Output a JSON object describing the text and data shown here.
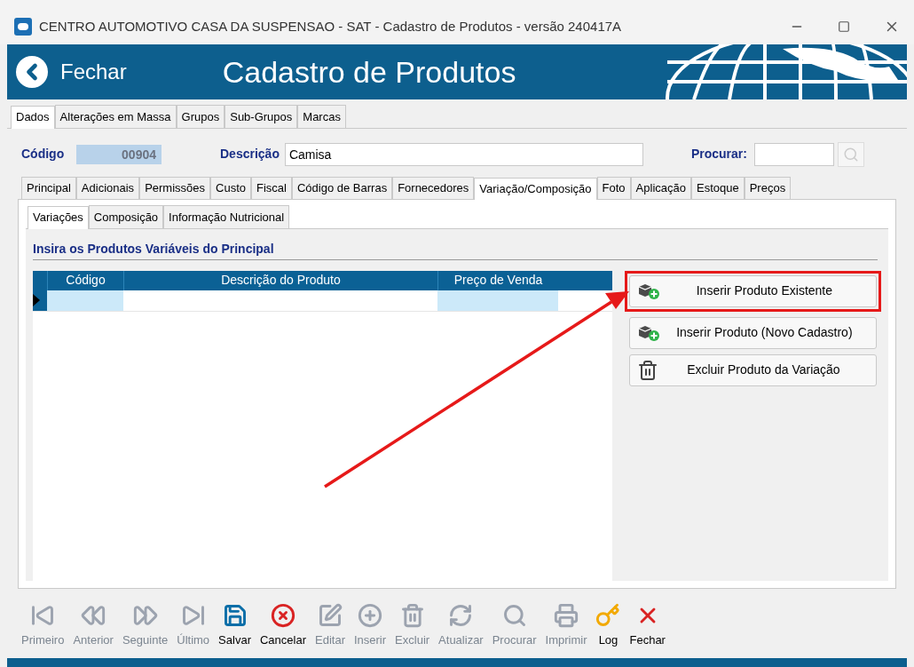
{
  "window": {
    "title": "CENTRO AUTOMOTIVO CASA DA SUSPENSAO  - SAT - Cadastro de Produtos - versão 240417A"
  },
  "header": {
    "back_label": "Fechar",
    "title": "Cadastro de Produtos"
  },
  "top_tabs": [
    {
      "label": "Dados",
      "selected": true
    },
    {
      "label": "Alterações em Massa",
      "selected": false
    },
    {
      "label": "Grupos",
      "selected": false
    },
    {
      "label": "Sub-Grupos",
      "selected": false
    },
    {
      "label": "Marcas",
      "selected": false
    }
  ],
  "fields": {
    "codigo_label": "Código",
    "codigo_value": "00904",
    "descricao_label": "Descrição",
    "descricao_value": "Camisa",
    "procurar_label": "Procurar:"
  },
  "tabs": [
    {
      "label": "Principal",
      "selected": false
    },
    {
      "label": "Adicionais",
      "selected": false
    },
    {
      "label": "Permissões",
      "selected": false
    },
    {
      "label": "Custo",
      "selected": false
    },
    {
      "label": "Fiscal",
      "selected": false
    },
    {
      "label": "Código de Barras",
      "selected": false
    },
    {
      "label": "Fornecedores",
      "selected": false
    },
    {
      "label": "Variação/Composição",
      "selected": true
    },
    {
      "label": "Foto",
      "selected": false
    },
    {
      "label": "Aplicação",
      "selected": false
    },
    {
      "label": "Estoque",
      "selected": false
    },
    {
      "label": "Preços",
      "selected": false
    }
  ],
  "sub_tabs": [
    {
      "label": "Variações",
      "selected": true
    },
    {
      "label": "Composição",
      "selected": false
    },
    {
      "label": "Informação Nutricional",
      "selected": false
    }
  ],
  "section_title": "Insira os Produtos Variáveis do Principal",
  "table": {
    "columns": [
      "Código",
      "Descrição do Produto",
      "Preço de Venda"
    ]
  },
  "actions": [
    {
      "label": "Inserir Produto Existente",
      "kind": "add",
      "highlighted": true
    },
    {
      "label": "Inserir Produto (Novo Cadastro)",
      "kind": "add",
      "highlighted": false
    },
    {
      "label": "Excluir Produto da Variação",
      "kind": "delete",
      "highlighted": false
    }
  ],
  "toolbar": [
    {
      "label": "Primeiro",
      "kind": "first",
      "disabled": true
    },
    {
      "label": "Anterior",
      "kind": "prev",
      "disabled": true
    },
    {
      "label": "Seguinte",
      "kind": "next",
      "disabled": true
    },
    {
      "label": "Último",
      "kind": "last",
      "disabled": true
    },
    {
      "label": "Salvar",
      "kind": "save",
      "disabled": false
    },
    {
      "label": "Cancelar",
      "kind": "cancel",
      "disabled": false
    },
    {
      "label": "Editar",
      "kind": "edit",
      "disabled": true
    },
    {
      "label": "Inserir",
      "kind": "insert",
      "disabled": true
    },
    {
      "label": "Excluir",
      "kind": "delete",
      "disabled": true
    },
    {
      "label": "Atualizar",
      "kind": "refresh",
      "disabled": true
    },
    {
      "label": "Procurar",
      "kind": "search",
      "disabled": true
    },
    {
      "label": "Imprimir",
      "kind": "print",
      "disabled": true
    },
    {
      "label": "Log",
      "kind": "log",
      "disabled": false
    },
    {
      "label": "Fechar",
      "kind": "close",
      "disabled": false
    }
  ]
}
